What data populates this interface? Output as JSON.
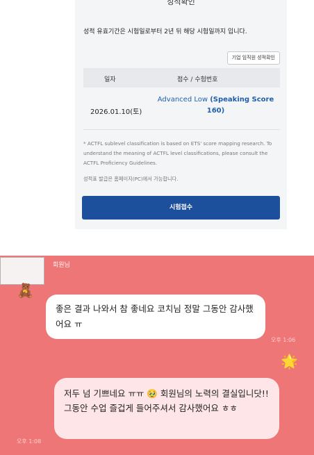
{
  "score_card": {
    "title": "성적확인",
    "notice": "성적 유효기간은 시험일로부터 2년 뒤 해당 시험일까지 입니다.",
    "corp_button_label": "기업 임직원 성적확인",
    "table": {
      "headers": [
        "일자",
        "점수 / 수험번호"
      ],
      "rows": [
        {
          "date": "2026.01.10(토)",
          "score_level": "Advanced Low",
          "score_detail": "(Speaking Score 160)"
        }
      ]
    },
    "footnote": "* ACTFL sublevel classification is based on ETS' score mapping research. To understand the meaning of ACTFL level classifications, please consult the ACTFL Proficiency Guidelines.",
    "pc_note": "성적표 발급은 홈페이지(PC)에서 가능합니다.",
    "apply_button_label": "시험접수"
  },
  "chat": {
    "sender_name": "회원님",
    "messages": [
      {
        "side": "left",
        "text": "좋은 결과 나와서 참 좋네요 코치님 정말 그동안 감사했어요 ㅠ",
        "time": "오후 1:06"
      },
      {
        "side": "right",
        "text": "저두 넘 기쁘네요 ㅠㅠ 🥹 회원님의 노력의 결실입니닷!! 그동안 수업 즐겁게 들어주셔서 감사했어요 ㅎㅎ",
        "time": "오후 1:08"
      }
    ],
    "bg_color": "#ee7676"
  }
}
